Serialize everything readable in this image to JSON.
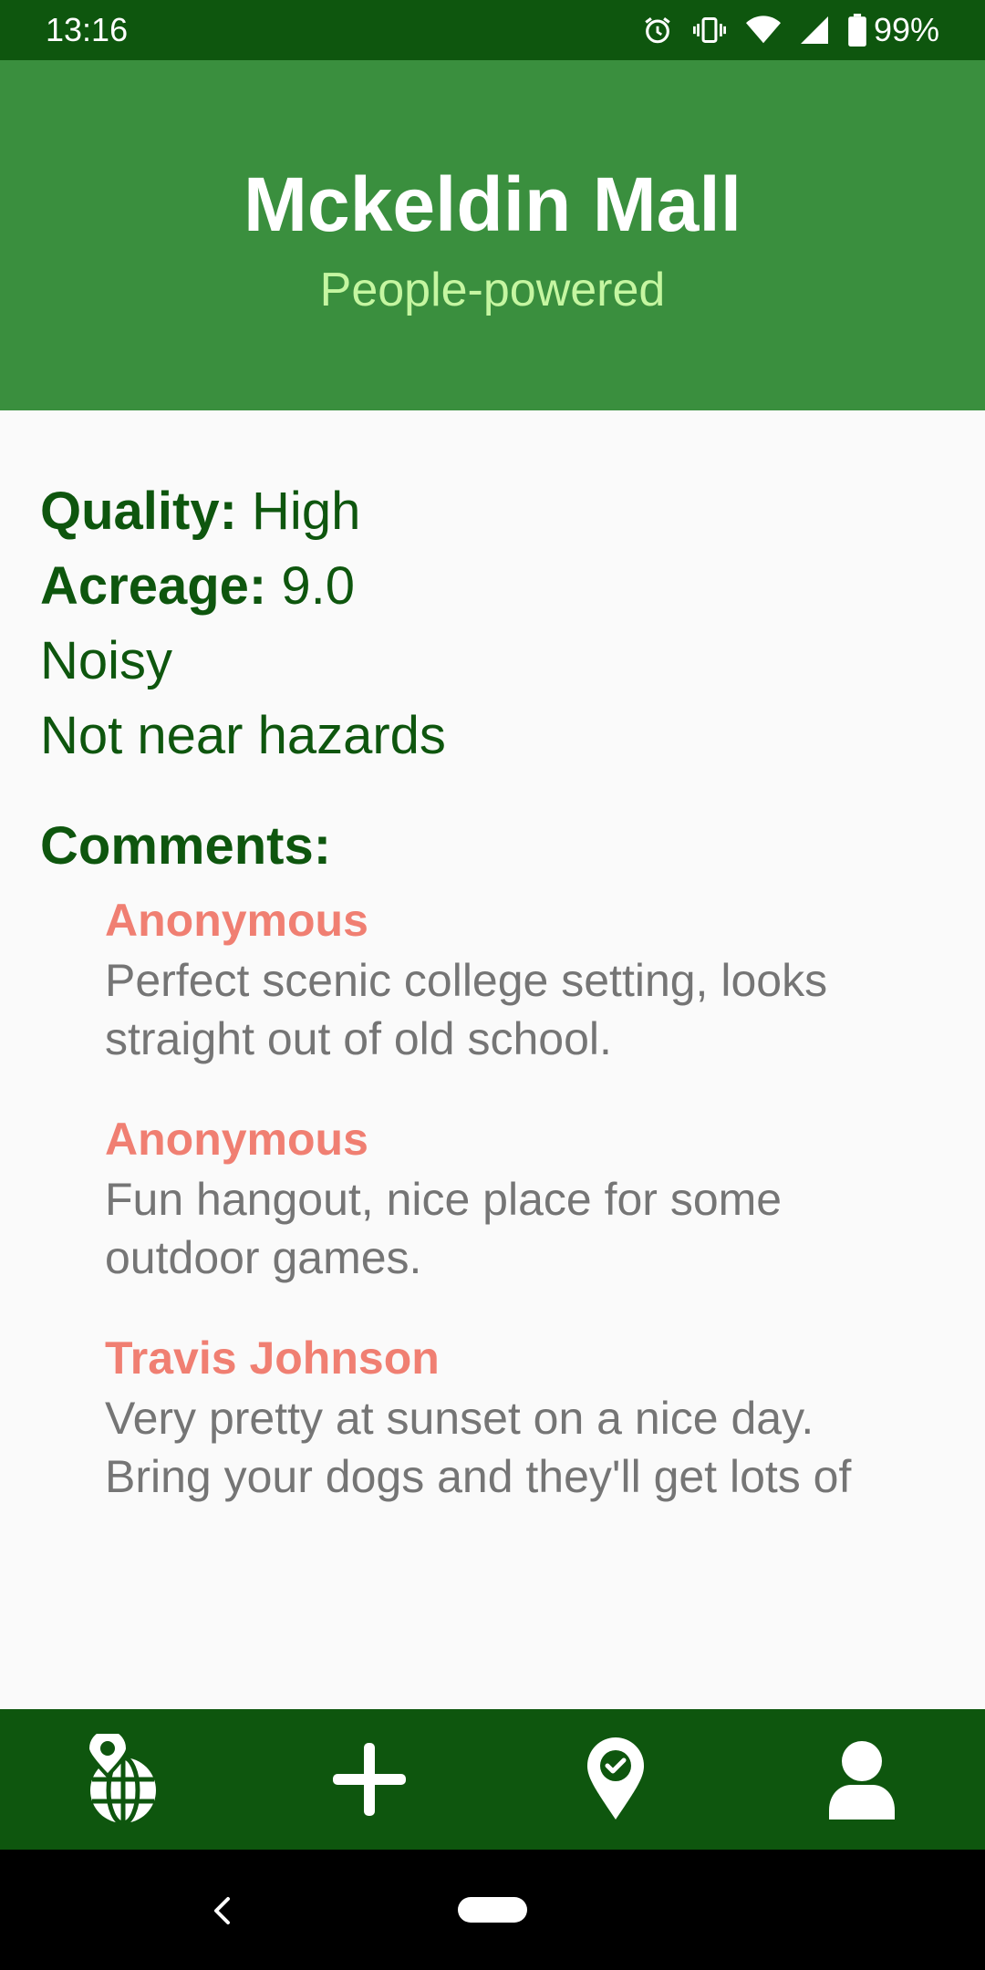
{
  "status_bar": {
    "time": "13:16",
    "battery": "99%",
    "icons": [
      "alarm-icon",
      "vibrate-icon",
      "wifi-icon",
      "signal-icon",
      "battery-icon"
    ]
  },
  "header": {
    "title": "Mckeldin Mall",
    "subtitle": "People-powered"
  },
  "details": {
    "quality_label": "Quality:",
    "quality_value": "High",
    "acreage_label": "Acreage:",
    "acreage_value": "9.0",
    "noise": "Noisy",
    "hazards": "Not near hazards"
  },
  "comments": {
    "heading": "Comments:",
    "items": [
      {
        "author": "Anonymous",
        "text": "Perfect scenic college setting, looks straight out of old school."
      },
      {
        "author": "Anonymous",
        "text": "Fun hangout, nice place for some outdoor games."
      },
      {
        "author": "Travis Johnson",
        "text": "Very pretty at sunset on a nice day. Bring your dogs and they'll get lots of"
      }
    ]
  },
  "bottom_nav": {
    "items": [
      "globe-pin-icon",
      "plus-icon",
      "location-check-icon",
      "person-icon"
    ]
  },
  "colors": {
    "dark_green": "#0e560e",
    "header_green": "#3a8f3e",
    "subtitle_green": "#c5f6a1",
    "author_salmon": "#f07f72",
    "comment_gray": "#757575"
  }
}
